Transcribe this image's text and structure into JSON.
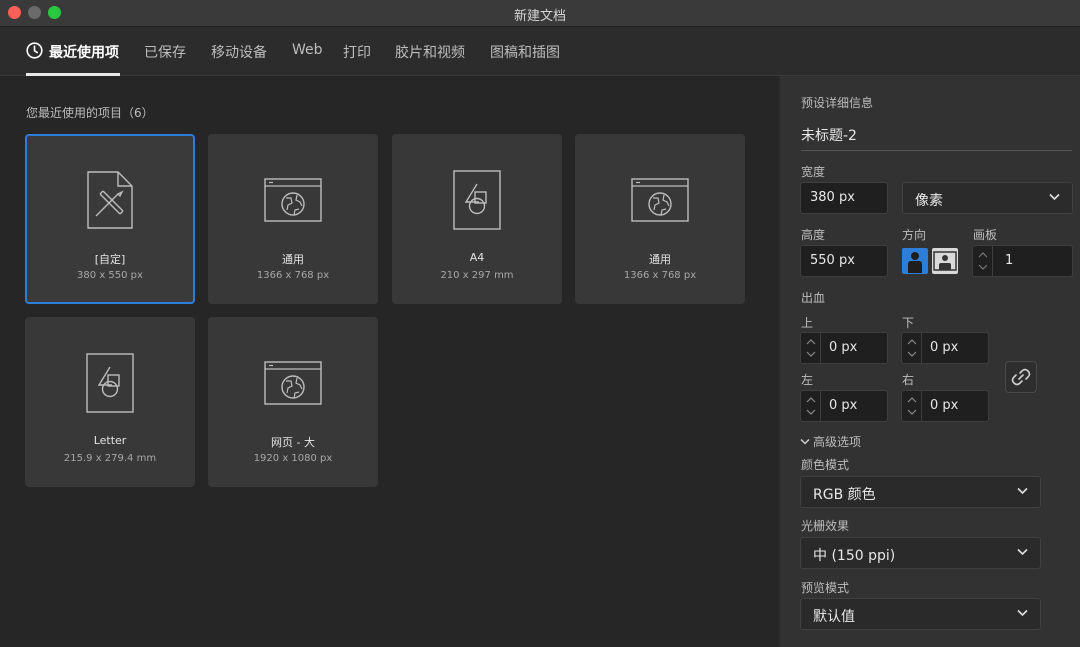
{
  "window": {
    "title": "新建文档"
  },
  "tabs": [
    {
      "label": "最近使用项"
    },
    {
      "label": "已保存"
    },
    {
      "label": "移动设备"
    },
    {
      "label": "Web"
    },
    {
      "label": "打印"
    },
    {
      "label": "胶片和视频"
    },
    {
      "label": "图稿和插图"
    }
  ],
  "recent": {
    "heading": "您最近使用的项目（6）",
    "items": [
      {
        "name": "[自定]",
        "size": "380 x 550 px",
        "icon": "custom-document-icon"
      },
      {
        "name": "通用",
        "size": "1366 x 768 px",
        "icon": "web-globe-icon"
      },
      {
        "name": "A4",
        "size": "210 x 297 mm",
        "icon": "print-document-icon"
      },
      {
        "name": "通用",
        "size": "1366 x 768 px",
        "icon": "web-globe-icon"
      },
      {
        "name": "Letter",
        "size": "215.9 x 279.4 mm",
        "icon": "print-document-icon"
      },
      {
        "name": "网页 - 大",
        "size": "1920 x 1080 px",
        "icon": "web-globe-icon"
      }
    ]
  },
  "preset": {
    "heading": "预设详细信息",
    "doc_name": "未标题-2",
    "width_label": "宽度",
    "width_value": "380 px",
    "unit_value": "像素",
    "height_label": "高度",
    "height_value": "550 px",
    "orientation_label": "方向",
    "artboards_label": "画板",
    "artboards_value": "1",
    "bleed_label": "出血",
    "bleed_top_label": "上",
    "bleed_top": "0 px",
    "bleed_bottom_label": "下",
    "bleed_bottom": "0 px",
    "bleed_left_label": "左",
    "bleed_left": "0 px",
    "bleed_right_label": "右",
    "bleed_right": "0 px",
    "advanced_label": "高级选项",
    "color_mode_label": "颜色模式",
    "color_mode_value": "RGB 颜色",
    "raster_label": "光栅效果",
    "raster_value": "中 (150 ppi)",
    "preview_label": "预览模式",
    "preview_value": "默认值"
  },
  "colors": {
    "accent": "#2d7ed8",
    "close": "#fe5f57",
    "maximize": "#28c840"
  }
}
